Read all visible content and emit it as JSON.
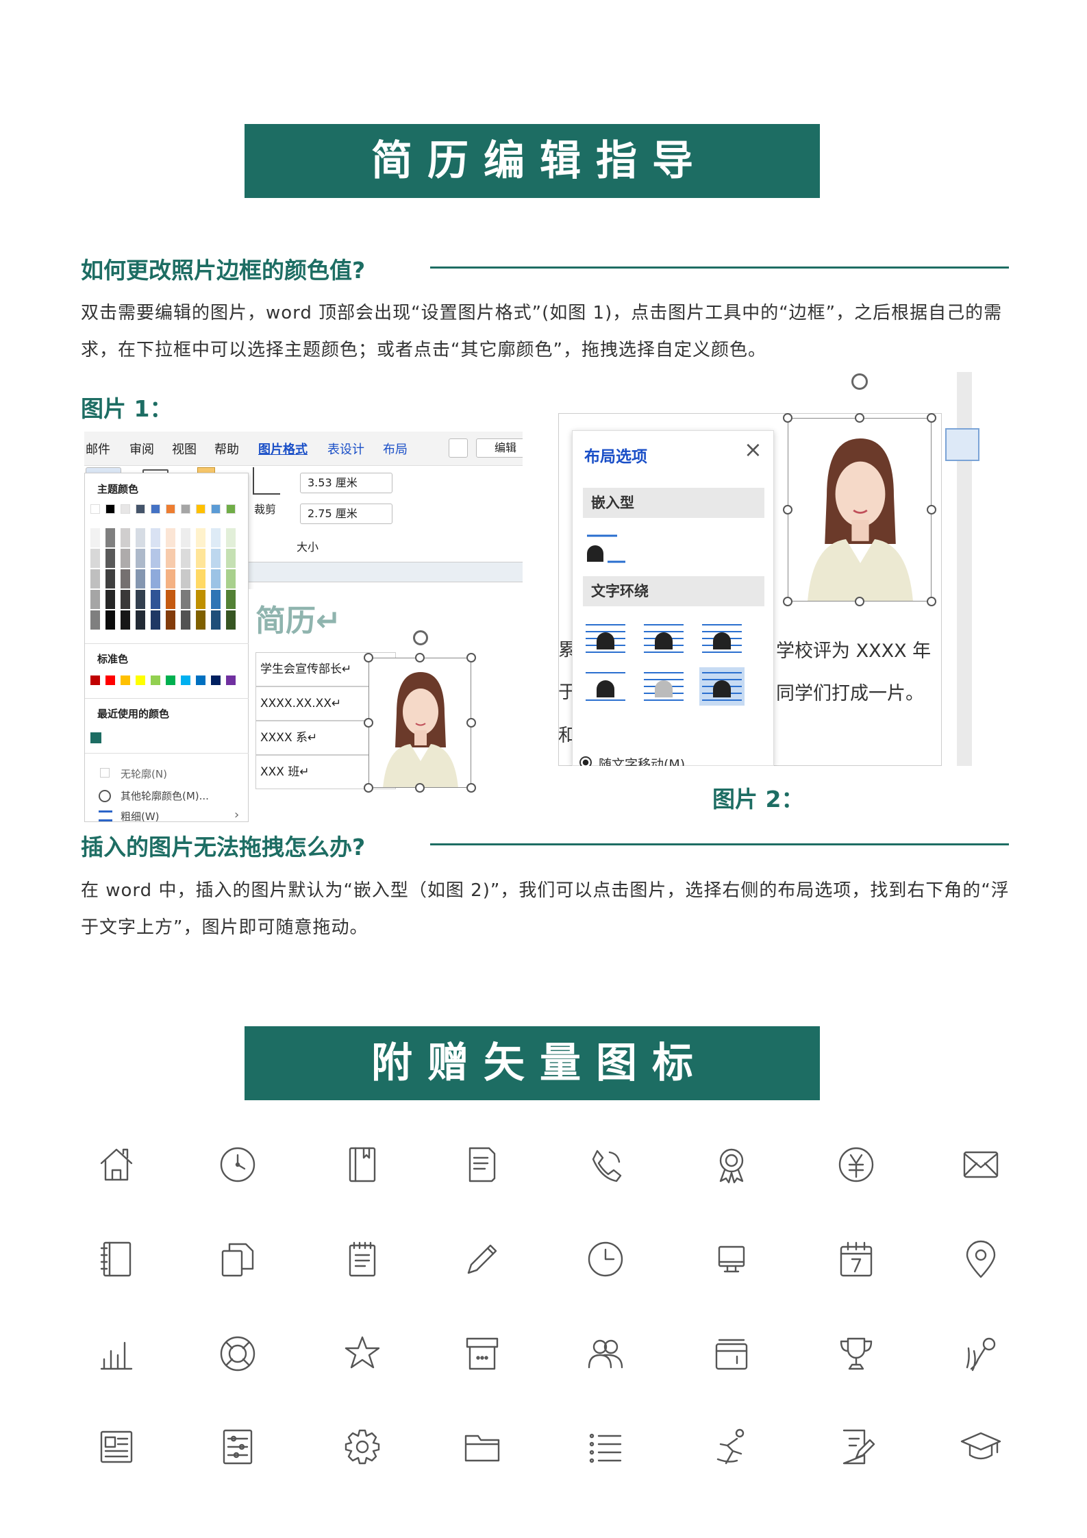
{
  "banner1": "简历编辑指导",
  "section1": {
    "title": "如何更改照片边框的颜色值?",
    "body": "双击需要编辑的图片，word 顶部会出现“设置图片格式”(如图 1)，点击图片工具中的“边框”，之后根据自己的需求，在下拉框中可以选择主题颜色；或者点击“其它廓颜色”，拖拽选择自定义颜色。",
    "caption1": "图片 1：",
    "caption2": "图片 2："
  },
  "fig1": {
    "tabs": [
      "邮件",
      "审阅",
      "视图",
      "帮助",
      "图片格式",
      "表设计",
      "布局"
    ],
    "edit_label": "编辑",
    "crop_label": "裁剪",
    "height_value": "3.53 厘米",
    "width_value": "2.75 厘米",
    "size_label": "大小",
    "theme_colors_label": "主题颜色",
    "standard_colors_label": "标准色",
    "recent_colors_label": "最近使用的颜色",
    "no_outline": "无轮廓(N)",
    "more_colors": "其他轮廓颜色(M)...",
    "weight": "粗细(W)",
    "doc_title": "简历↵",
    "rows": [
      "学生会宣传部长↵",
      "XXXX.XX.XX↵",
      "XXXX 系↵",
      "XXX 班↵"
    ]
  },
  "fig2": {
    "panel_title": "布局选项",
    "inline_label": "嵌入型",
    "wrap_label": "文字环绕",
    "move_with_text": "随文字移动(M)",
    "doc_line1": "学校评为 XXXX 年",
    "doc_line2": "同学们打成一片。",
    "left_chars": [
      "累",
      "于",
      "和"
    ]
  },
  "section2": {
    "title": "插入的图片无法拖拽怎么办?",
    "body": "在 word 中，插入的图片默认为“嵌入型（如图 2)”，我们可以点击图片，选择右侧的布局选项，找到右下角的“浮于文字上方”，图片即可随意拖动。"
  },
  "banner2": "附赠矢量图标",
  "icons": [
    "home-icon",
    "clock-icon",
    "notebook-icon",
    "document-icon",
    "phone-icon",
    "award-icon",
    "yen-icon",
    "mail-icon",
    "ledger-icon",
    "copy-icon",
    "notepad-icon",
    "pencil-icon",
    "time-icon",
    "monitor-icon",
    "calendar-icon",
    "location-icon",
    "bar-chart-icon",
    "lifebuoy-icon",
    "star-icon",
    "archive-icon",
    "users-icon",
    "cards-icon",
    "trophy-icon",
    "microphone-icon",
    "newspaper-icon",
    "settings-sliders-icon",
    "gear-icon",
    "folder-icon",
    "list-icon",
    "skating-icon",
    "edit-doc-icon",
    "graduation-cap-icon"
  ],
  "colors": {
    "accent": "#1d6d63",
    "text": "#333333",
    "blue": "#1a4fc7"
  }
}
